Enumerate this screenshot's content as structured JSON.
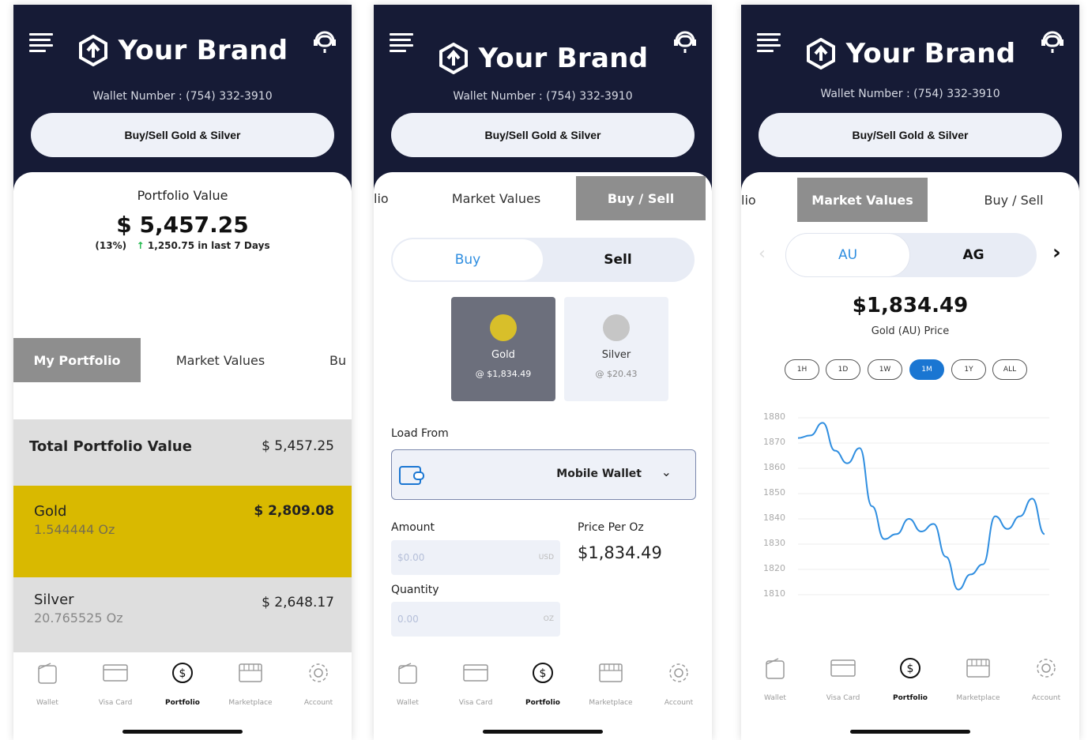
{
  "brand": {
    "name": "Your Brand"
  },
  "wallet_number": "Wallet Number : (754) 332-3910",
  "buy_sell_button": "Buy/Sell Gold & Silver",
  "nav": [
    "Wallet",
    "Visa Card",
    "Portfolio",
    "Marketplace",
    "Account"
  ],
  "phone1": {
    "tabs": [
      "My Portfolio",
      "Market Values",
      "Bu"
    ],
    "portfolio_value_label": "Portfolio Value",
    "portfolio_value": "$ 5,457.25",
    "change_pct": "(13%)",
    "change_text": "1,250.75 in last 7 Days",
    "rows": [
      {
        "label": "Total Portfolio Value",
        "value": "$ 5,457.25",
        "sub": ""
      },
      {
        "label": "Gold",
        "value": "$ 2,809.08",
        "sub": "1.544444 Oz"
      },
      {
        "label": "Silver",
        "value": "$ 2,648.17",
        "sub": "20.765525 Oz"
      }
    ]
  },
  "phone2": {
    "tabs": [
      "lio",
      "Market Values",
      "Buy / Sell"
    ],
    "segment": [
      "Buy",
      "Sell"
    ],
    "metals": [
      {
        "name": "Gold",
        "price": "@ $1,834.49"
      },
      {
        "name": "Silver",
        "price": "@ $20.43"
      }
    ],
    "load_from_label": "Load From",
    "load_from_value": "Mobile Wallet",
    "amount_label": "Amount",
    "amount_placeholder": "$0.00",
    "amount_unit": "USD",
    "price_per_oz_label": "Price Per Oz",
    "price_per_oz": "$1,834.49",
    "quantity_label": "Quantity",
    "quantity_placeholder": "0.00",
    "quantity_unit": "OZ"
  },
  "phone3": {
    "tabs": [
      "lio",
      "Market Values",
      "Buy / Sell"
    ],
    "segment": [
      "AU",
      "AG"
    ],
    "price": "$1,834.49",
    "price_label": "Gold (AU) Price",
    "ranges": [
      "1H",
      "1D",
      "1W",
      "1M",
      "1Y",
      "ALL"
    ],
    "selected_range": "1M",
    "colors": {
      "line": "#2f8ee0",
      "selected": "#1a76d2"
    }
  },
  "chart_data": {
    "type": "line",
    "title": "",
    "xlabel": "",
    "ylabel": "",
    "y_tick_labels": [
      "1880",
      "1870",
      "1860",
      "1850",
      "1840",
      "1830",
      "1820",
      "1810"
    ],
    "ylim": [
      1810,
      1880
    ],
    "series": [
      {
        "values": [
          1872,
          1873,
          1878,
          1867,
          1862,
          1868,
          1845,
          1832,
          1834,
          1840,
          1835,
          1838,
          1825,
          1812,
          1818,
          1822,
          1841,
          1836,
          1841,
          1848,
          1834
        ]
      }
    ]
  }
}
